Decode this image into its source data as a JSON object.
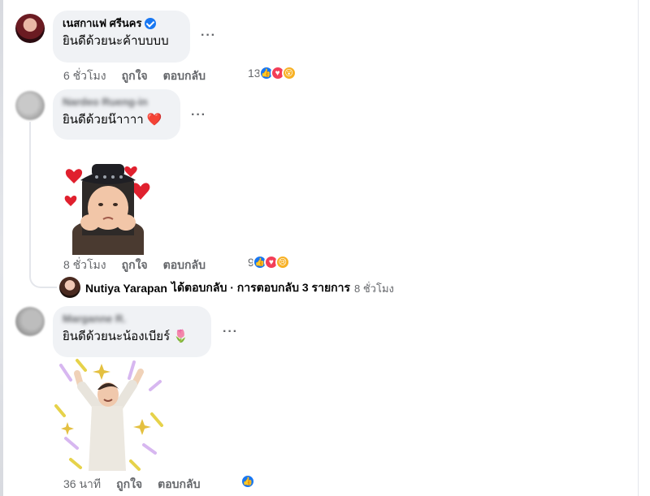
{
  "comments": [
    {
      "author": "เนสกาแฟ ศรีนคร",
      "verified": true,
      "text": "ยินดีด้วยนะค้าบบบบ",
      "time": "6 ชั่วโมง",
      "like_label": "ถูกใจ",
      "reply_label": "ตอบกลับ",
      "reaction_count": "13",
      "reactions": [
        "like-icon",
        "love-icon",
        "wow-icon"
      ]
    },
    {
      "author": "Nardeo Rueng-in",
      "verified": false,
      "text": "ยินดีด้วยน๊าาาา ❤️",
      "time": "8 ชั่วโมง",
      "like_label": "ถูกใจ",
      "reply_label": "ตอบกลับ",
      "reaction_count": "9",
      "reactions": [
        "like-icon",
        "love-icon",
        "sad-icon"
      ],
      "sticker": "girl-with-hearts-sticker",
      "replies": {
        "name": "Nutiya Yarapan",
        "text": "ได้ตอบกลับ · การตอบกลับ 3 รายการ",
        "time": "8 ชั่วโมง"
      }
    },
    {
      "author": "Marganne R.",
      "verified": false,
      "text": "ยินดีด้วยนะน้องเบียร์ 🌷",
      "time": "36 นาที",
      "like_label": "ถูกใจ",
      "reply_label": "ตอบกลับ",
      "reactions": [
        "like-icon"
      ],
      "sticker": "celebrating-man-sticker"
    }
  ],
  "more_label": "···",
  "colors": {
    "bubble": "#f0f2f5",
    "meta": "#65676b",
    "like": "#1877f2",
    "love": "#f33e58",
    "wow": "#f7b125"
  }
}
